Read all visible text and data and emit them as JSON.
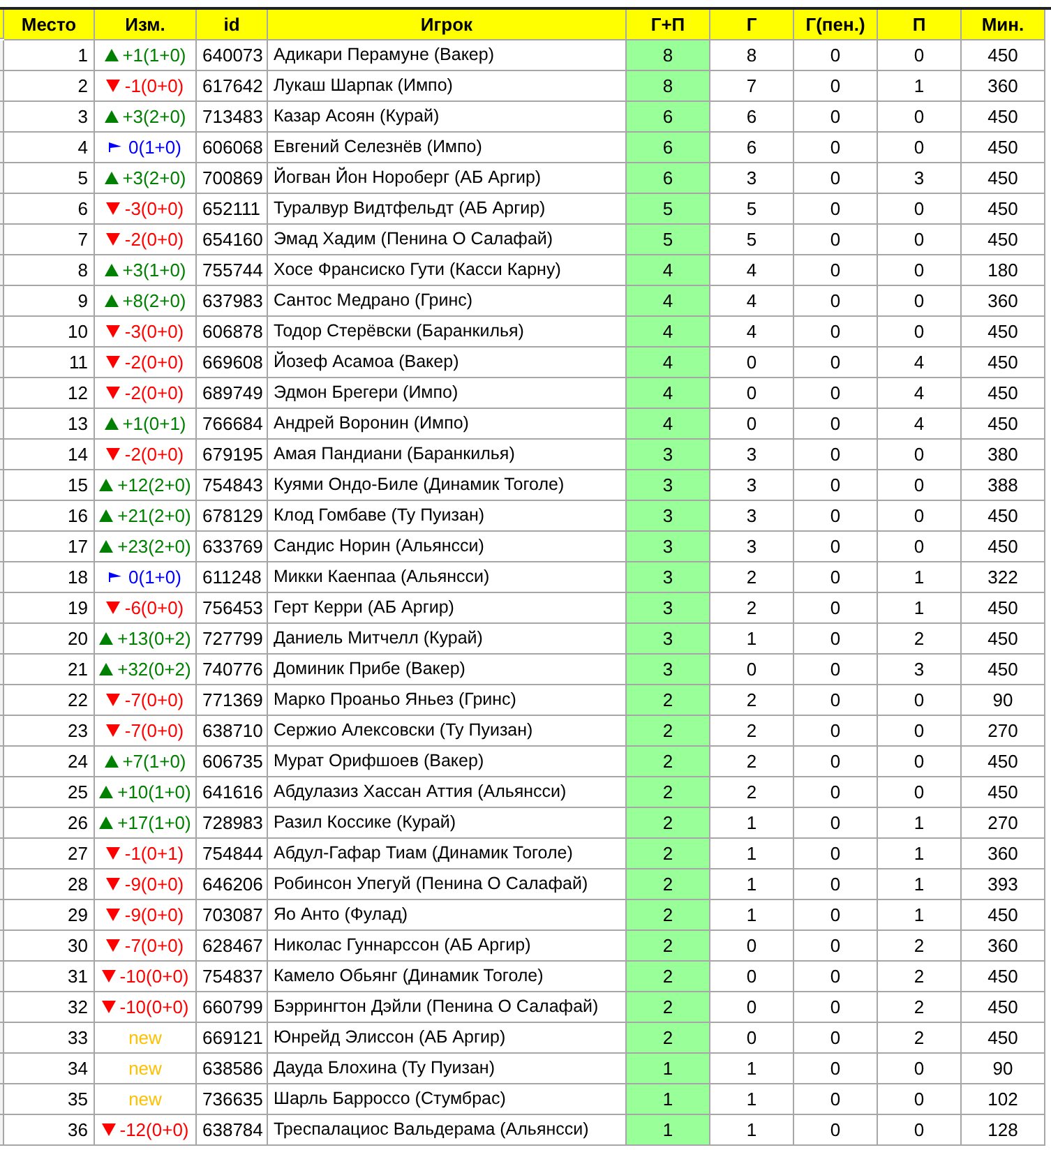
{
  "columns": [
    "Место",
    "Изм.",
    "id",
    "Игрок",
    "Г+П",
    "Г",
    "Г(пен.)",
    "П",
    "Мин."
  ],
  "rows": [
    {
      "place": "1",
      "change": {
        "kind": "up",
        "text": "+1(1+0)"
      },
      "id": "640073",
      "player": "Адикари Перамуне (Вакер)",
      "gp": "8",
      "g": "8",
      "gpen": "0",
      "p": "0",
      "min": "450"
    },
    {
      "place": "2",
      "change": {
        "kind": "down",
        "text": "-1(0+0)"
      },
      "id": "617642",
      "player": "Лукаш Шарпак (Импо)",
      "gp": "8",
      "g": "7",
      "gpen": "0",
      "p": "1",
      "min": "360"
    },
    {
      "place": "3",
      "change": {
        "kind": "up",
        "text": "+3(2+0)"
      },
      "id": "713483",
      "player": "Казар Асоян (Курай)",
      "gp": "6",
      "g": "6",
      "gpen": "0",
      "p": "0",
      "min": "450"
    },
    {
      "place": "4",
      "change": {
        "kind": "same",
        "text": "0(1+0)"
      },
      "id": "606068",
      "player": "Евгений Селезнёв (Импо)",
      "gp": "6",
      "g": "6",
      "gpen": "0",
      "p": "0",
      "min": "450"
    },
    {
      "place": "5",
      "change": {
        "kind": "up",
        "text": "+3(2+0)"
      },
      "id": "700869",
      "player": "Йогван Йон Нороберг (АБ Аргир)",
      "gp": "6",
      "g": "3",
      "gpen": "0",
      "p": "3",
      "min": "450"
    },
    {
      "place": "6",
      "change": {
        "kind": "down",
        "text": "-3(0+0)"
      },
      "id": "652111",
      "player": "Туралвур Видтфельдт (АБ Аргир)",
      "gp": "5",
      "g": "5",
      "gpen": "0",
      "p": "0",
      "min": "450"
    },
    {
      "place": "7",
      "change": {
        "kind": "down",
        "text": "-2(0+0)"
      },
      "id": "654160",
      "player": "Эмад Хадим (Пенина О Салафай)",
      "gp": "5",
      "g": "5",
      "gpen": "0",
      "p": "0",
      "min": "450"
    },
    {
      "place": "8",
      "change": {
        "kind": "up",
        "text": "+3(1+0)"
      },
      "id": "755744",
      "player": "Хосе Франсиско Гути (Касси Карну)",
      "gp": "4",
      "g": "4",
      "gpen": "0",
      "p": "0",
      "min": "180"
    },
    {
      "place": "9",
      "change": {
        "kind": "up",
        "text": "+8(2+0)"
      },
      "id": "637983",
      "player": "Сантос Медрано (Гринс)",
      "gp": "4",
      "g": "4",
      "gpen": "0",
      "p": "0",
      "min": "360"
    },
    {
      "place": "10",
      "change": {
        "kind": "down",
        "text": "-3(0+0)"
      },
      "id": "606878",
      "player": "Тодор Стерёвски (Баранкилья)",
      "gp": "4",
      "g": "4",
      "gpen": "0",
      "p": "0",
      "min": "450"
    },
    {
      "place": "11",
      "change": {
        "kind": "down",
        "text": "-2(0+0)"
      },
      "id": "669608",
      "player": "Йозеф Асамоа (Вакер)",
      "gp": "4",
      "g": "0",
      "gpen": "0",
      "p": "4",
      "min": "450"
    },
    {
      "place": "12",
      "change": {
        "kind": "down",
        "text": "-2(0+0)"
      },
      "id": "689749",
      "player": "Эдмон Брегери (Импо)",
      "gp": "4",
      "g": "0",
      "gpen": "0",
      "p": "4",
      "min": "450"
    },
    {
      "place": "13",
      "change": {
        "kind": "up",
        "text": "+1(0+1)"
      },
      "id": "766684",
      "player": "Андрей Воронин (Импо)",
      "gp": "4",
      "g": "0",
      "gpen": "0",
      "p": "4",
      "min": "450"
    },
    {
      "place": "14",
      "change": {
        "kind": "down",
        "text": "-2(0+0)"
      },
      "id": "679195",
      "player": "Амая Пандиани (Баранкилья)",
      "gp": "3",
      "g": "3",
      "gpen": "0",
      "p": "0",
      "min": "380"
    },
    {
      "place": "15",
      "change": {
        "kind": "up",
        "text": "+12(2+0)"
      },
      "id": "754843",
      "player": "Куями Ондо-Биле (Динамик Тоголе)",
      "gp": "3",
      "g": "3",
      "gpen": "0",
      "p": "0",
      "min": "388"
    },
    {
      "place": "16",
      "change": {
        "kind": "up",
        "text": "+21(2+0)"
      },
      "id": "678129",
      "player": "Клод Гомбаве (Ту Пуизан)",
      "gp": "3",
      "g": "3",
      "gpen": "0",
      "p": "0",
      "min": "450"
    },
    {
      "place": "17",
      "change": {
        "kind": "up",
        "text": "+23(2+0)"
      },
      "id": "633769",
      "player": "Сандис Норин (Альянсси)",
      "gp": "3",
      "g": "3",
      "gpen": "0",
      "p": "0",
      "min": "450"
    },
    {
      "place": "18",
      "change": {
        "kind": "same",
        "text": "0(1+0)"
      },
      "id": "611248",
      "player": "Микки Каенпаа (Альянсси)",
      "gp": "3",
      "g": "2",
      "gpen": "0",
      "p": "1",
      "min": "322"
    },
    {
      "place": "19",
      "change": {
        "kind": "down",
        "text": "-6(0+0)"
      },
      "id": "756453",
      "player": "Герт Керри (АБ Аргир)",
      "gp": "3",
      "g": "2",
      "gpen": "0",
      "p": "1",
      "min": "450"
    },
    {
      "place": "20",
      "change": {
        "kind": "up",
        "text": "+13(0+2)"
      },
      "id": "727799",
      "player": "Даниель Митчелл (Курай)",
      "gp": "3",
      "g": "1",
      "gpen": "0",
      "p": "2",
      "min": "450"
    },
    {
      "place": "21",
      "change": {
        "kind": "up",
        "text": "+32(0+2)"
      },
      "id": "740776",
      "player": "Доминик Прибе (Вакер)",
      "gp": "3",
      "g": "0",
      "gpen": "0",
      "p": "3",
      "min": "450"
    },
    {
      "place": "22",
      "change": {
        "kind": "down",
        "text": "-7(0+0)"
      },
      "id": "771369",
      "player": "Марко Проаньо Яньез (Гринс)",
      "gp": "2",
      "g": "2",
      "gpen": "0",
      "p": "0",
      "min": "90"
    },
    {
      "place": "23",
      "change": {
        "kind": "down",
        "text": "-7(0+0)"
      },
      "id": "638710",
      "player": "Сержио Алексовски (Ту Пуизан)",
      "gp": "2",
      "g": "2",
      "gpen": "0",
      "p": "0",
      "min": "270"
    },
    {
      "place": "24",
      "change": {
        "kind": "up",
        "text": "+7(1+0)"
      },
      "id": "606735",
      "player": "Мурат Орифшоев (Вакер)",
      "gp": "2",
      "g": "2",
      "gpen": "0",
      "p": "0",
      "min": "450"
    },
    {
      "place": "25",
      "change": {
        "kind": "up",
        "text": "+10(1+0)"
      },
      "id": "641616",
      "player": "Абдулазиз Хассан Аттия (Альянсси)",
      "gp": "2",
      "g": "2",
      "gpen": "0",
      "p": "0",
      "min": "450"
    },
    {
      "place": "26",
      "change": {
        "kind": "up",
        "text": "+17(1+0)"
      },
      "id": "728983",
      "player": "Разил Коссике (Курай)",
      "gp": "2",
      "g": "1",
      "gpen": "0",
      "p": "1",
      "min": "270"
    },
    {
      "place": "27",
      "change": {
        "kind": "down",
        "text": "-1(0+1)"
      },
      "id": "754844",
      "player": "Абдул-Гафар Тиам (Динамик Тоголе)",
      "gp": "2",
      "g": "1",
      "gpen": "0",
      "p": "1",
      "min": "360"
    },
    {
      "place": "28",
      "change": {
        "kind": "down",
        "text": "-9(0+0)"
      },
      "id": "646206",
      "player": "Робинсон Упегуй (Пенина О Салафай)",
      "gp": "2",
      "g": "1",
      "gpen": "0",
      "p": "1",
      "min": "393"
    },
    {
      "place": "29",
      "change": {
        "kind": "down",
        "text": "-9(0+0)"
      },
      "id": "703087",
      "player": "Яо Анто (Фулад)",
      "gp": "2",
      "g": "1",
      "gpen": "0",
      "p": "1",
      "min": "450"
    },
    {
      "place": "30",
      "change": {
        "kind": "down",
        "text": "-7(0+0)"
      },
      "id": "628467",
      "player": "Николас Гуннарссон (АБ Аргир)",
      "gp": "2",
      "g": "0",
      "gpen": "0",
      "p": "2",
      "min": "360"
    },
    {
      "place": "31",
      "change": {
        "kind": "down",
        "text": "-10(0+0)"
      },
      "id": "754837",
      "player": "Камело Обьянг (Динамик Тоголе)",
      "gp": "2",
      "g": "0",
      "gpen": "0",
      "p": "2",
      "min": "450"
    },
    {
      "place": "32",
      "change": {
        "kind": "down",
        "text": "-10(0+0)"
      },
      "id": "660799",
      "player": "Бэррингтон Дэйли (Пенина О Салафай)",
      "gp": "2",
      "g": "0",
      "gpen": "0",
      "p": "2",
      "min": "450"
    },
    {
      "place": "33",
      "change": {
        "kind": "new",
        "text": "new"
      },
      "id": "669121",
      "player": "Юнрейд Элиссон (АБ Аргир)",
      "gp": "2",
      "g": "0",
      "gpen": "0",
      "p": "2",
      "min": "450"
    },
    {
      "place": "34",
      "change": {
        "kind": "new",
        "text": "new"
      },
      "id": "638586",
      "player": "Дауда Блохина (Ту Пуизан)",
      "gp": "1",
      "g": "1",
      "gpen": "0",
      "p": "0",
      "min": "90"
    },
    {
      "place": "35",
      "change": {
        "kind": "new",
        "text": "new"
      },
      "id": "736635",
      "player": "Шарль Барроссо (Стумбрас)",
      "gp": "1",
      "g": "1",
      "gpen": "0",
      "p": "0",
      "min": "102"
    },
    {
      "place": "36",
      "change": {
        "kind": "down",
        "text": "-12(0+0)"
      },
      "id": "638784",
      "player": "Треспалациос Вальдерама (Альянсси)",
      "gp": "1",
      "g": "1",
      "gpen": "0",
      "p": "0",
      "min": "128"
    }
  ]
}
